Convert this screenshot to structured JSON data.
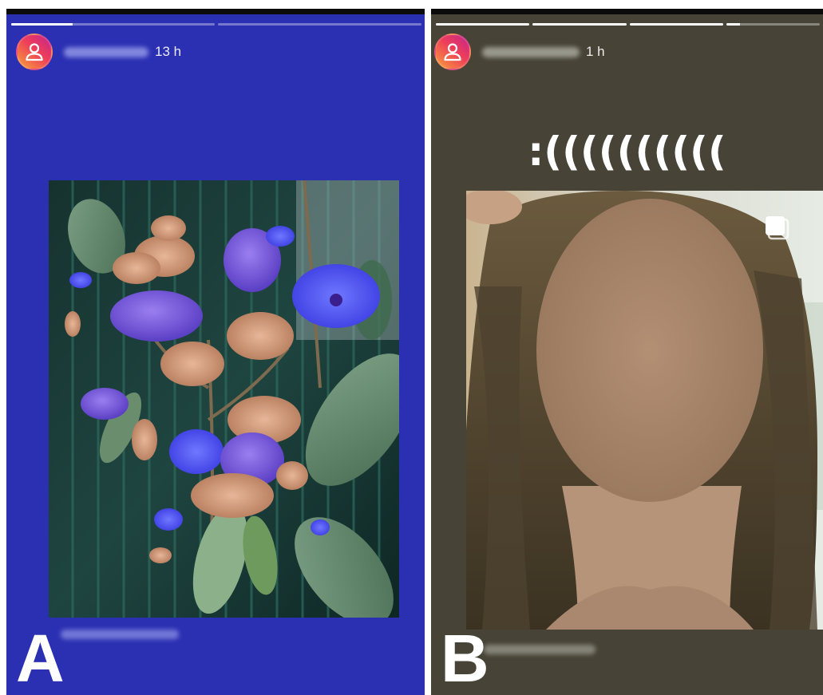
{
  "panels": [
    {
      "id": "A",
      "label": "A",
      "background": "#2b30b3",
      "time": "13 h",
      "progress": [
        0.3,
        0.0
      ]
    },
    {
      "id": "B",
      "label": "B",
      "background": "#474437",
      "time": "1 h",
      "caption": ":((((((((((",
      "progress": [
        1.0,
        1.0,
        1.0,
        0.15
      ]
    }
  ],
  "icons": {
    "avatar": "person-outline-icon",
    "multiple_photos": "carousel-icon"
  },
  "colors": {
    "avatar_gradient": [
      "#f9a13a",
      "#ee3f59",
      "#c4238c"
    ]
  }
}
